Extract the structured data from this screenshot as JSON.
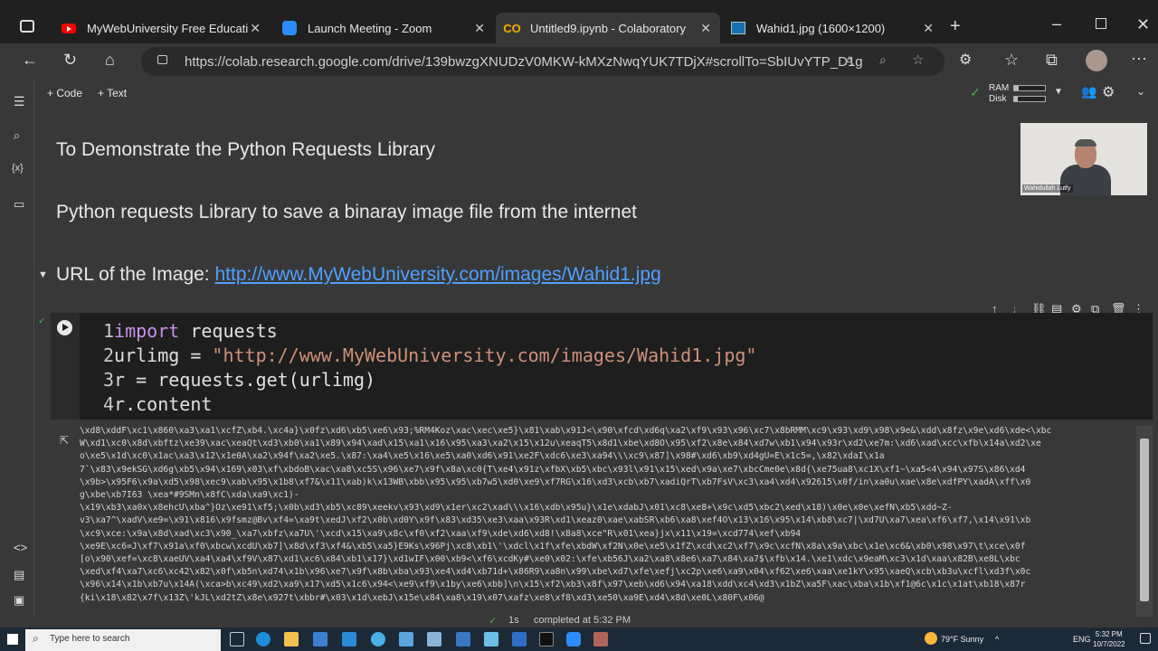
{
  "browser": {
    "tabs": [
      {
        "title": "MyWebUniversity Free Education",
        "icon": "youtube-icon"
      },
      {
        "title": "Launch Meeting - Zoom",
        "icon": "zoom-icon"
      },
      {
        "title": "Untitled9.ipynb - Colaboratory",
        "icon": "colab-icon",
        "active": true
      },
      {
        "title": "Wahid1.jpg (1600×1200)",
        "icon": "image-icon"
      }
    ],
    "url": "https://colab.research.google.com/drive/139bwzgXNUDzV0MKW-kMXzNwqYUK7TDjX#scrollTo=SbIUvYTP_D1g"
  },
  "toolbar": {
    "code_label": "+ Code",
    "text_label": "+ Text",
    "ram_label": "RAM",
    "disk_label": "Disk",
    "ram_fraction": 0.15,
    "disk_fraction": 0.12
  },
  "notebook": {
    "heading1": "To Demonstrate the Python Requests Library",
    "heading2": "Python requests Library to save a binaray image file from the internet",
    "heading3_prefix": "URL of the Image: ",
    "heading3_link": "http://www.MyWebUniversity.com/images/Wahid1.jpg",
    "code": {
      "line_numbers": [
        "1",
        "2",
        "3",
        "4"
      ],
      "line1_kw": "import",
      "line1_rest": " requests",
      "line2_pre": "urlimg = ",
      "line2_str": "\"http://www.MyWebUniversity.com/images/Wahid1.jpg\"",
      "line3": "r = requests.get(urlimg)",
      "line4": "r.content"
    },
    "output_lines": [
      "\\xd8\\xddF\\xc1\\x860\\xa3\\xa1\\xcfZ\\xb4.\\xc4a}\\x0fz\\xd6\\xb5\\xe6\\x93;%RM4Koz\\xac\\xec\\xe5}\\x81\\xab\\x91J<\\x90\\xfcd\\xd6q\\xa2\\xf9\\x93\\x96\\xc7\\x8bRMM\\xc9\\x93\\xd9\\x98\\x9e&\\xdd\\x8fz\\x9e\\xd6\\xde<\\xbc",
      "W\\xd1\\xc0\\x8d\\xbftz\\xe39\\xac\\xeaQt\\xd3\\xb0\\xa1\\x89\\x94\\xad\\x15\\xa1\\x16\\x95\\xa3\\xa2\\x15\\x12u\\xeaqT5\\x8d1\\xbe\\xd8O\\x95\\xf2\\x8e\\x84\\xd7w\\xb1\\x94\\x93r\\xd2\\xe7m:\\xd6\\xad\\xcc\\xfb\\x14a\\xd2\\xe",
      "o\\xe5\\x1d\\xc0\\x1ac\\xa3\\x12\\x1e0A\\xa2\\x94f\\xa2\\xe5.\\x87:\\xa4\\xe5\\x16\\xe5\\xa0\\xd6\\x91\\xe2F\\xdc6\\xe3\\xa94\\\\\\xc9\\x87]\\x98#\\xd6\\xb9\\xd4gU=E\\x1c5=,\\x82\\xdaI\\x1a",
      "7`\\x83\\x9ekSG\\xd6g\\xb5\\x94\\x169\\x03\\xf\\xbdoB\\xac\\xa8\\xc5S\\x96\\xe7\\x9f\\x8a\\xc0{T\\xe4\\x91z\\xfbX\\xb5\\xbc\\x93l\\x91\\x15\\xed\\x9a\\xe7\\xbcCme0e\\x8d{\\xe75ua8\\xc1X\\xf1~\\xa5<4\\x94\\x97S\\x86\\xd4",
      "\\x9b>\\x95F6\\x9a\\xd5\\x98\\xec9\\xab\\x95\\x1b8\\xf7&\\x11\\xab)k\\x13WB\\xbb\\x95\\x95\\xb7w5\\xd0\\xe9\\xf7RG\\x16\\xd3\\xcb\\xb7\\xadiQrT\\xb7FsV\\xc3\\xa4\\xd4\\x92615\\x0f/in\\xa0u\\xae\\x8e\\xdfPY\\xadA\\xff\\x0",
      "g\\xbe\\xb7I63 \\xea*#9SMn\\x8fC\\xda\\xa9\\xc1)-",
      "\\x19\\xb3\\xa0x\\x8ehcU\\xba^}Oz\\xe91\\xf5;\\x0b\\xd3\\xb5\\xc89\\xeekv\\x93\\xd9\\x1er\\xc2\\xad\\\\\\x16\\xdb\\x95u}\\x1e\\xdabJ\\x01\\xc8\\xe8+\\x9c\\xd5\\xbc2\\xed\\x18)\\x0e\\x0e\\xefN\\xb5\\xdd~Z-",
      "v3\\xa7^\\xadV\\xe9=\\x91\\x816\\x9fsmz@Bv\\xf4=\\xa9t\\xedJ\\xf2\\x0b\\xd0Y\\x9f\\x83\\xd35\\xe3\\xaa\\x93R\\xd1\\xeaz0\\xae\\xabSR\\xb6\\xa8\\xef4O\\x13\\x16\\x95\\x14\\xb8\\xc7|\\xd7U\\xa7\\xea\\xf6\\xf7,\\x14\\x91\\xb",
      "\\xc9\\xce:\\x9a\\x8d\\xad\\xc3\\x90_\\xa7\\xbfz\\xa7U\\'\\xcd\\x15\\xa9\\x8c\\xf0\\xf2\\xaa\\xf9\\xde\\xd6\\xd8!\\x8a8\\xce\"R\\x01\\xea}jx\\x11\\x19=\\xcd774\\xef\\xb94",
      "\\xe9E\\xc6=J\\xf7\\x91a\\xf0\\xbcw\\xcdU\\xb7]\\x8d\\xf3\\xf4&\\xb5\\xa5}E9Ks\\x96Pj\\xc8\\xb1\\'\\xdcl\\x1f\\xfe\\xbdW\\xf2N\\x0e\\xe5\\x1fZ\\xcd\\xc2\\xf7\\x9c\\xcfN\\x8a\\x9a\\xbc\\x1e\\xc6&\\xb0\\x98\\x97\\t\\xce\\x0f",
      "[o\\x90\\xef=\\xc8\\xaeUV\\xa4\\xa4\\xf9V\\x87\\xd1\\xc6\\x84\\xb1\\x17}\\xd1wIF\\x00\\xb9<\\xf6\\xcdKy#\\xe0\\x02:\\xfe\\xb56J\\xa2\\xa8\\x8e6\\xa7\\x84\\xa7$\\xfb\\x14.\\xe1\\xdc\\x9eaM\\xc3\\x1d\\xaa\\x82B\\xe8L\\xbc",
      "\\xed\\xf4\\xa7\\xc6\\xc42\\x82\\x0f\\xb5n\\xd74\\x1b\\x96\\xe7\\x9f\\x8b\\xba\\x93\\xe4\\xd4\\xb71d+\\x86R9\\xa8n\\x99\\xbe\\xd7\\xfe\\xefj\\xc2p\\xe6\\xa9\\x04\\xf62\\xe6\\xaa\\xe1kY\\x95\\xaeQ\\xcb\\xb3u\\xcfl\\xd3f\\x0c",
      "\\x96\\x14\\x1b\\xb7u\\x14A(\\xca>b\\xc49\\xd2\\xa9\\x17\\xd5\\x1c6\\x94<\\xe9\\xf9\\x1by\\xe6\\xbb]\\n\\x15\\xf2\\xb3\\x8f\\x97\\xeb\\xd6\\x94\\xa18\\xdd\\xc4\\xd3\\x1bZ\\xa5F\\xac\\xba\\x1b\\xf1@6c\\x1c\\x1at\\xb18\\x87r",
      "{ki\\x18\\x82\\x7f\\x13Z\\'kJL\\xd2tZ\\x8e\\x927t\\xbbr#\\x03\\x1d\\xebJ\\x15e\\x84\\xa8\\x19\\x07\\xafz\\xe8\\xf8\\xd3\\xe50\\xa9E\\xd4\\x8d\\xe0L\\x80F\\x06@"
    ]
  },
  "status": {
    "elapsed": "1s",
    "message": "completed at 5:32 PM"
  },
  "video": {
    "participant_name": "Wahidullah Lutfy"
  },
  "taskbar": {
    "search_placeholder": "Type here to search",
    "weather": "79°F  Sunny",
    "lang": "ENG",
    "time": "5:32 PM",
    "date": "10/7/2022"
  }
}
